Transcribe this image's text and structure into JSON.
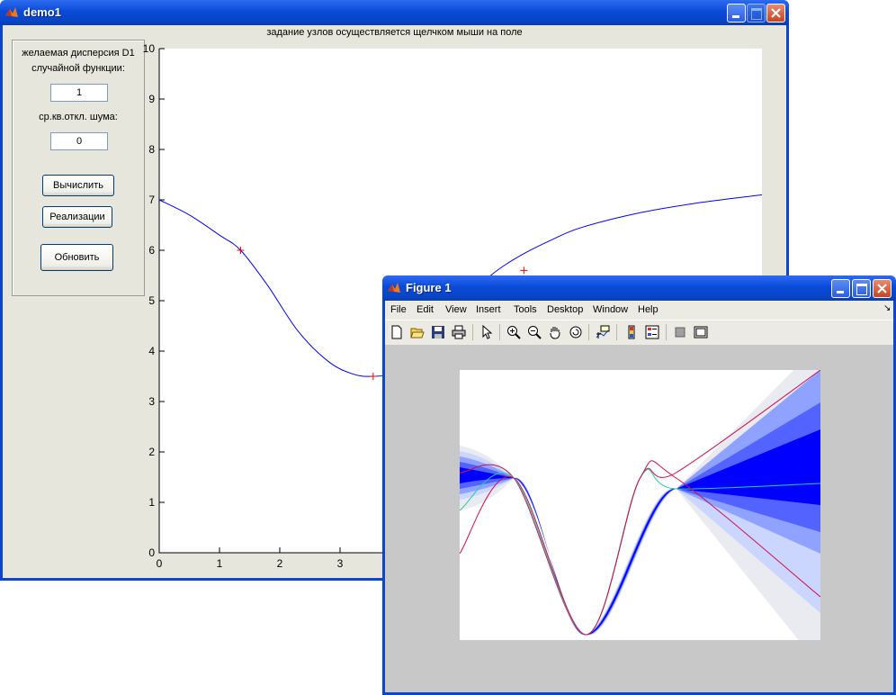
{
  "demo1": {
    "title": "demo1",
    "hint": "задание узлов осуществляется щелчком мыши на поле",
    "panel": {
      "label_variance_1": "желаемая дисперсия D1",
      "label_variance_2": "случайной функции:",
      "variance_value": "1",
      "label_noise": "ср.кв.откл. шума:",
      "noise_value": "0",
      "btn_compute": "Вычислить",
      "btn_realizations": "Реализации",
      "btn_update": "Обновить"
    },
    "plot": {
      "xticks": [
        "0",
        "1",
        "2",
        "3"
      ],
      "yticks": [
        "0",
        "1",
        "2",
        "3",
        "4",
        "5",
        "6",
        "7",
        "8",
        "9",
        "10"
      ]
    }
  },
  "figure1": {
    "title": "Figure 1",
    "menu": [
      "File",
      "Edit",
      "View",
      "Insert",
      "Tools",
      "Desktop",
      "Window",
      "Help"
    ],
    "toolbar_icons": [
      "new-figure-icon",
      "open-file-icon",
      "save-icon",
      "print-icon",
      "pointer-icon",
      "zoom-in-icon",
      "zoom-out-icon",
      "pan-hand-icon",
      "rotate-3d-icon",
      "data-cursor-icon",
      "colorbar-icon",
      "legend-icon",
      "hide-plot-tools-icon",
      "show-plot-tools-icon"
    ]
  },
  "chart_data": [
    {
      "type": "line",
      "title": "",
      "xlabel": "",
      "ylabel": "",
      "xlim": [
        0,
        10
      ],
      "ylim": [
        0,
        10
      ],
      "grid": false,
      "series": [
        {
          "x": [
            0,
            0.5,
            1.0,
            1.35,
            1.8,
            2.3,
            2.8,
            3.2,
            3.55,
            4.0,
            4.5,
            5.0,
            5.5,
            6.0,
            6.5,
            7.0,
            8.0,
            9.0,
            10.0
          ],
          "y": [
            7.0,
            6.7,
            6.3,
            6.0,
            5.3,
            4.4,
            3.8,
            3.55,
            3.5,
            3.6,
            4.1,
            4.9,
            5.5,
            5.9,
            6.2,
            6.45,
            6.75,
            6.95,
            7.1
          ]
        }
      ],
      "markers": [
        {
          "x": 1.35,
          "y": 6.0
        },
        {
          "x": 3.55,
          "y": 3.5
        },
        {
          "x": 6.05,
          "y": 5.6
        }
      ]
    },
    {
      "type": "area",
      "title": "",
      "xlabel": "",
      "ylabel": "",
      "grid": false,
      "series": [
        {
          "x": [
            0,
            0.15,
            0.35,
            0.5,
            0.6,
            1.0
          ],
          "y": [
            0.62,
            0.6,
            0.02,
            0.6,
            0.62,
            1.0
          ]
        },
        {
          "x": [
            0,
            0.15,
            0.35,
            0.5,
            0.6,
            1.0
          ],
          "y": [
            0.48,
            0.6,
            0.02,
            0.6,
            0.56,
            0.58
          ]
        },
        {
          "x": [
            0,
            0.15,
            0.35,
            0.5,
            0.6,
            1.0
          ],
          "y": [
            0.32,
            0.6,
            0.02,
            0.6,
            0.6,
            0.16
          ]
        }
      ]
    }
  ]
}
